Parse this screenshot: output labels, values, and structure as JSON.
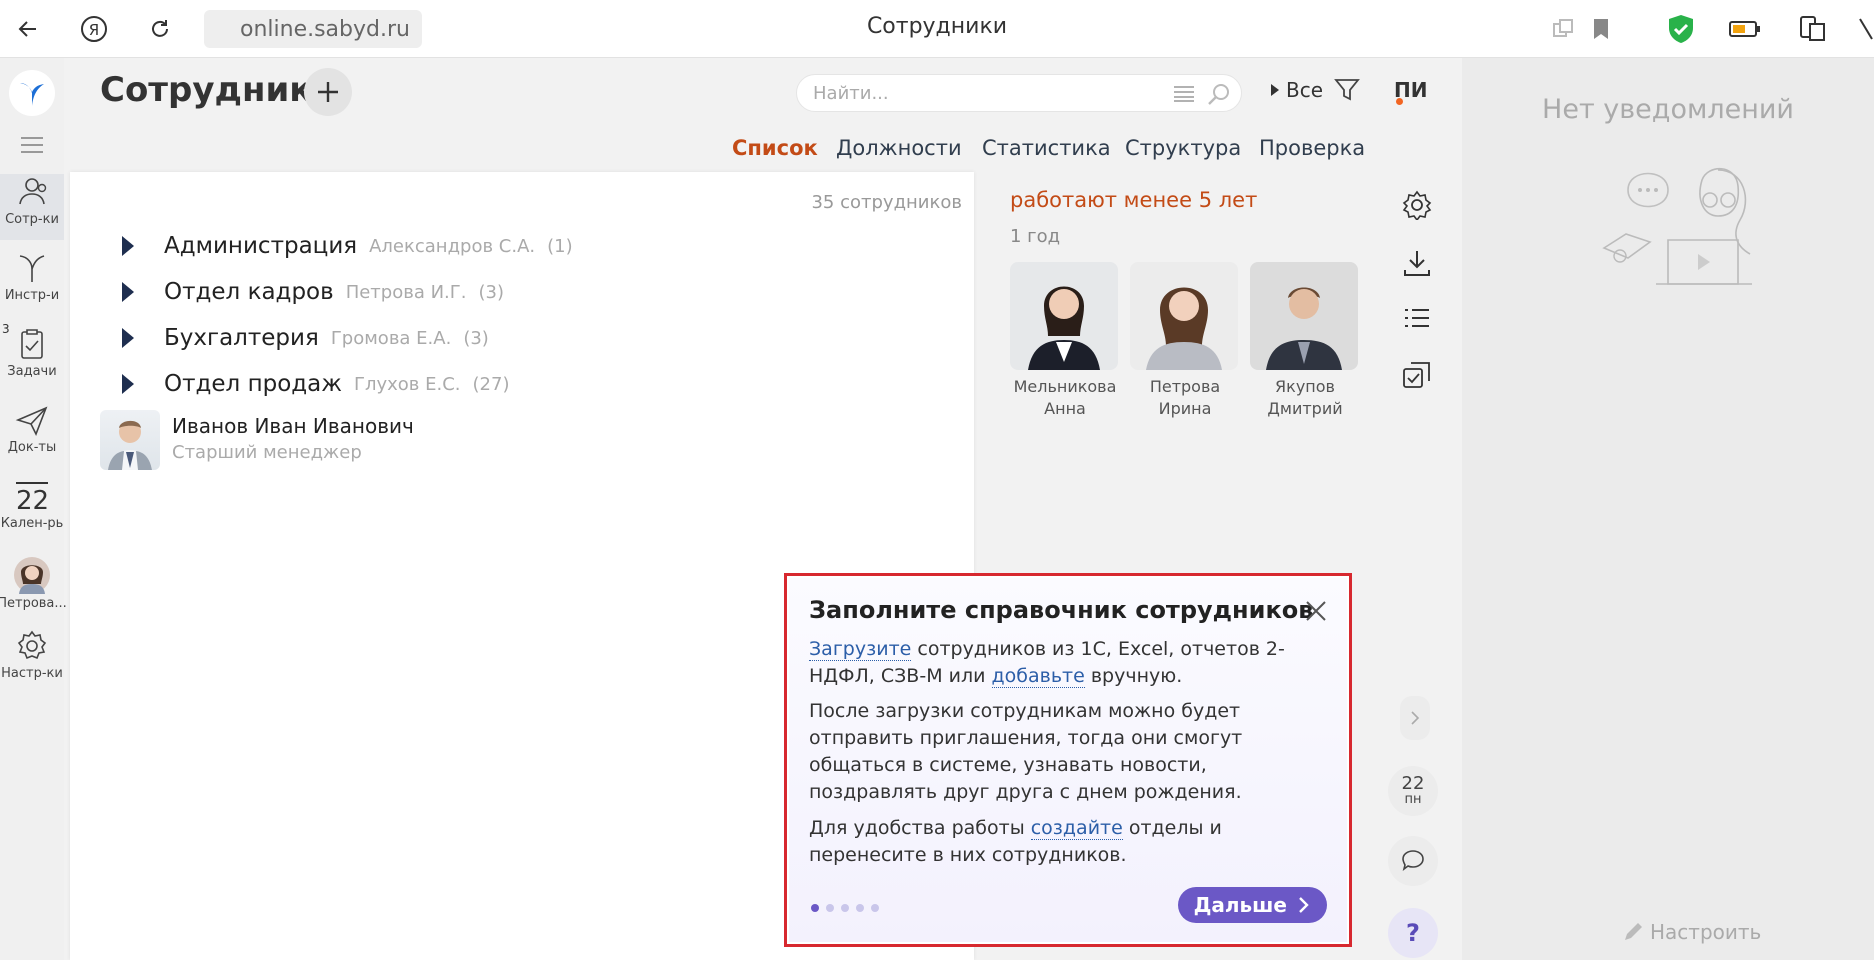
{
  "browser": {
    "url": "online.sabyd.ru",
    "tab_title": "Сотрудники"
  },
  "nav": {
    "task_badge": "3",
    "items": [
      {
        "label": "Сотр-ки",
        "icon": "people-icon"
      },
      {
        "label": "Инстр-и",
        "icon": "tools-icon"
      },
      {
        "label": "Задачи",
        "icon": "tasks-icon"
      },
      {
        "label": "Док-ты",
        "icon": "documents-icon"
      },
      {
        "label": "Кален-рь",
        "icon": "calendar-icon",
        "day": "22"
      },
      {
        "label": "Петрова...",
        "icon": "avatar"
      },
      {
        "label": "Настр-ки",
        "icon": "settings-icon"
      }
    ]
  },
  "header": {
    "title": "Сотрудники",
    "search_placeholder": "Найти...",
    "filter_label": "Все",
    "user_initials": "ПИ"
  },
  "tabs": [
    "Список",
    "Должности",
    "Статистика",
    "Структура",
    "Проверка"
  ],
  "list": {
    "count": "35 сотрудников",
    "departments": [
      {
        "name": "Администрация",
        "head": "Александров С.А.",
        "count": "(1)"
      },
      {
        "name": "Отдел кадров",
        "head": "Петрова И.Г.",
        "count": "(3)"
      },
      {
        "name": "Бухгалтерия",
        "head": "Громова Е.А.",
        "count": "(3)"
      },
      {
        "name": "Отдел продаж",
        "head": "Глухов Е.С.",
        "count": "(27)"
      }
    ],
    "person": {
      "name": "Иванов Иван Иванович",
      "position": "Старший менеджер"
    }
  },
  "widget": {
    "title": "работают менее 5 лет",
    "subtitle": "1 год",
    "people": [
      {
        "first": "Мельникова",
        "second": "Анна"
      },
      {
        "first": "Петрова",
        "second": "Ирина"
      },
      {
        "first": "Якупов",
        "second": "Дмитрий"
      }
    ]
  },
  "notifications": {
    "empty_text": "Нет уведомлений",
    "setup_label": "Настроить",
    "calendar_day": "22",
    "calendar_weekday": "пн",
    "help_label": "?"
  },
  "popup": {
    "title": "Заполните справочник сотрудников",
    "p1_link1": "Загрузите",
    "p1_text1": " сотрудников из 1С, Excel, отчетов 2-НДФЛ, СЗВ-М или ",
    "p1_link2": "добавьте",
    "p1_text2": " вручную.",
    "p2": "После загрузки сотрудникам можно будет отправить приглашения, тогда они смогут общаться в системе, узнавать новости, поздравлять друг друга с днем рождения.",
    "p3_text1": "Для удобства работы ",
    "p3_link": "создайте",
    "p3_text2": " отделы и перенесите в них сотрудников.",
    "next_label": "Дальше",
    "dots": 5,
    "active_dot": 1
  }
}
